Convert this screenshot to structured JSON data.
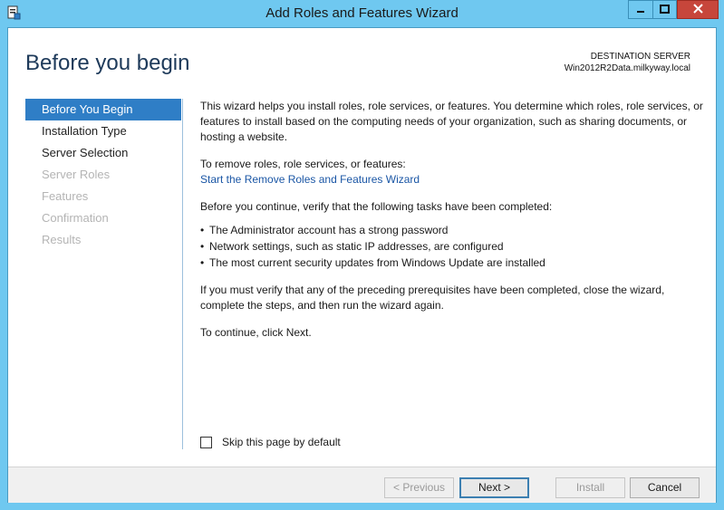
{
  "window": {
    "title": "Add Roles and Features Wizard"
  },
  "header": {
    "page_title": "Before you begin",
    "dest_label": "DESTINATION SERVER",
    "dest_server": "Win2012R2Data.milkyway.local"
  },
  "nav": {
    "items": [
      {
        "label": "Before You Begin",
        "state": "active"
      },
      {
        "label": "Installation Type",
        "state": "enabled"
      },
      {
        "label": "Server Selection",
        "state": "enabled"
      },
      {
        "label": "Server Roles",
        "state": "disabled"
      },
      {
        "label": "Features",
        "state": "disabled"
      },
      {
        "label": "Confirmation",
        "state": "disabled"
      },
      {
        "label": "Results",
        "state": "disabled"
      }
    ]
  },
  "content": {
    "intro": "This wizard helps you install roles, role services, or features. You determine which roles, role services, or features to install based on the computing needs of your organization, such as sharing documents, or hosting a website.",
    "remove_label": "To remove roles, role services, or features:",
    "remove_link": "Start the Remove Roles and Features Wizard",
    "verify": "Before you continue, verify that the following tasks have been completed:",
    "tasks": [
      "The Administrator account has a strong password",
      "Network settings, such as static IP addresses, are configured",
      "The most current security updates from Windows Update are installed"
    ],
    "prereq": "If you must verify that any of the preceding prerequisites have been completed, close the wizard, complete the steps, and then run the wizard again.",
    "continue": "To continue, click Next."
  },
  "skip": {
    "label": "Skip this page by default",
    "checked": false
  },
  "buttons": {
    "previous": "< Previous",
    "next": "Next >",
    "install": "Install",
    "cancel": "Cancel"
  },
  "colors": {
    "titlebar": "#6fc8f0",
    "close": "#c7463b",
    "nav_active": "#2f7ec6",
    "link": "#1a56a5"
  }
}
